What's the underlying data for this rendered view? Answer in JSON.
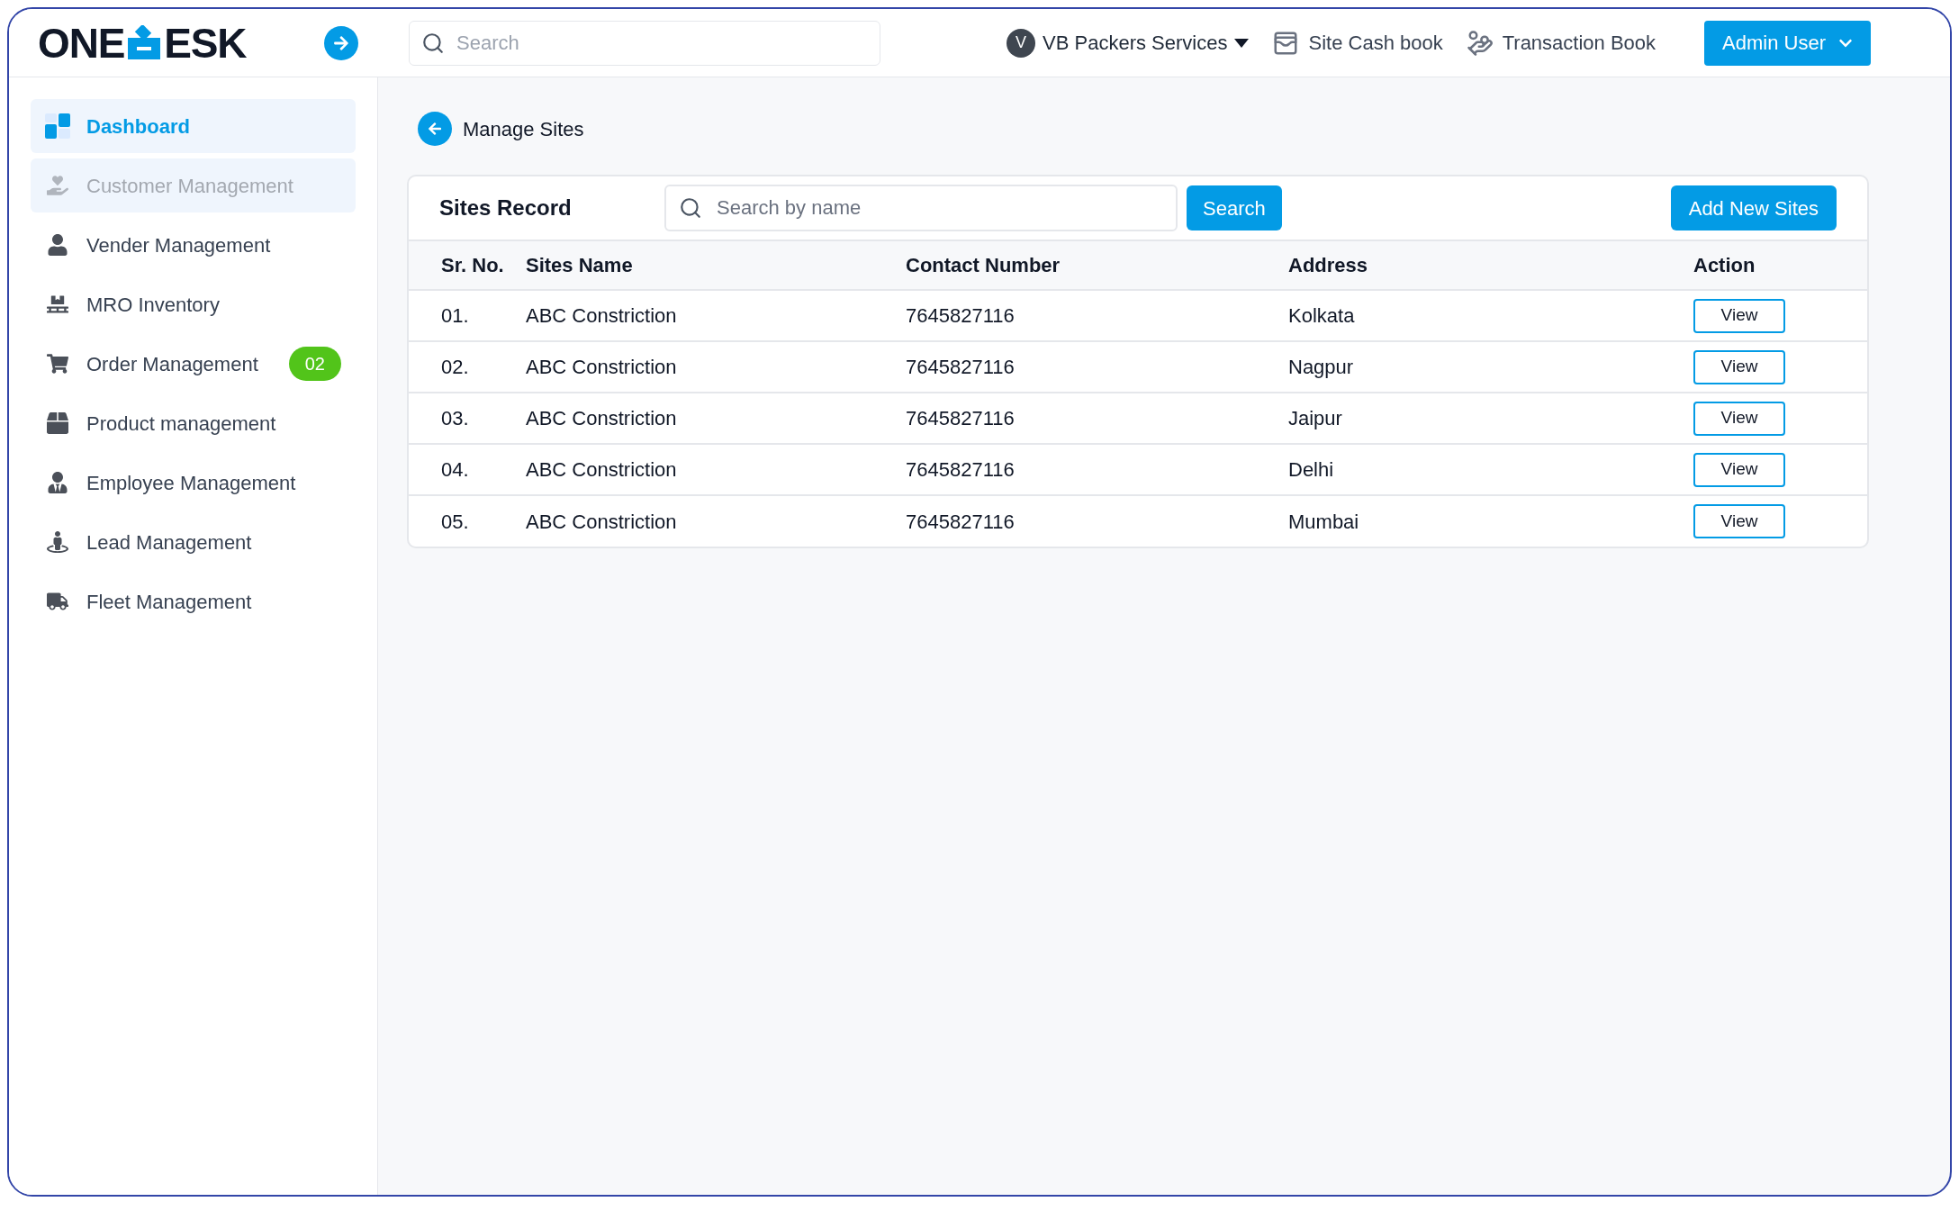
{
  "logo": {
    "left": "ONE",
    "right": "ESK"
  },
  "header": {
    "search": {
      "placeholder": "Search"
    },
    "company": {
      "initial": "V",
      "name": "VB Packers Services"
    },
    "links": [
      "Site Cash book",
      "Transaction Book"
    ],
    "user": "Admin User"
  },
  "sidebar": {
    "items": [
      {
        "kind": "dashboard",
        "label": "Dashboard",
        "selected": true,
        "hovered": false
      },
      {
        "kind": "customer",
        "label": "Customer Management",
        "selected": false,
        "hovered": true
      },
      {
        "kind": "vendor",
        "label": "Vender Management",
        "selected": false,
        "hovered": false
      },
      {
        "kind": "inventory",
        "label": "MRO Inventory",
        "selected": false,
        "hovered": false
      },
      {
        "kind": "order",
        "label": "Order Management",
        "selected": false,
        "hovered": false,
        "badge": "02"
      },
      {
        "kind": "product",
        "label": "Product management",
        "selected": false,
        "hovered": false
      },
      {
        "kind": "employee",
        "label": "Employee Management",
        "selected": false,
        "hovered": false
      },
      {
        "kind": "lead",
        "label": "Lead Management",
        "selected": false,
        "hovered": false
      },
      {
        "kind": "fleet",
        "label": "Fleet Management",
        "selected": false,
        "hovered": false
      }
    ]
  },
  "page_title": "Manage Sites",
  "card": {
    "title": "Sites Record",
    "search": {
      "placeholder": "Search by name"
    },
    "search_button": "Search",
    "add_button": "Add New Sites"
  },
  "table": {
    "columns": [
      "Sr. No.",
      "Sites Name",
      "Contact Number",
      "Address",
      "Action"
    ],
    "rows": [
      {
        "sr": "01.",
        "name": "ABC Constriction",
        "contact": "7645827116",
        "address": "Kolkata",
        "action": "View"
      },
      {
        "sr": "02.",
        "name": "ABC Constriction",
        "contact": "7645827116",
        "address": "Nagpur",
        "action": "View"
      },
      {
        "sr": "03.",
        "name": "ABC Constriction",
        "contact": "7645827116",
        "address": "Jaipur",
        "action": "View"
      },
      {
        "sr": "04.",
        "name": "ABC Constriction",
        "contact": "7645827116",
        "address": "Delhi",
        "action": "View"
      },
      {
        "sr": "05.",
        "name": "ABC Constriction",
        "contact": "7645827116",
        "address": "Mumbai",
        "action": "View"
      }
    ]
  }
}
